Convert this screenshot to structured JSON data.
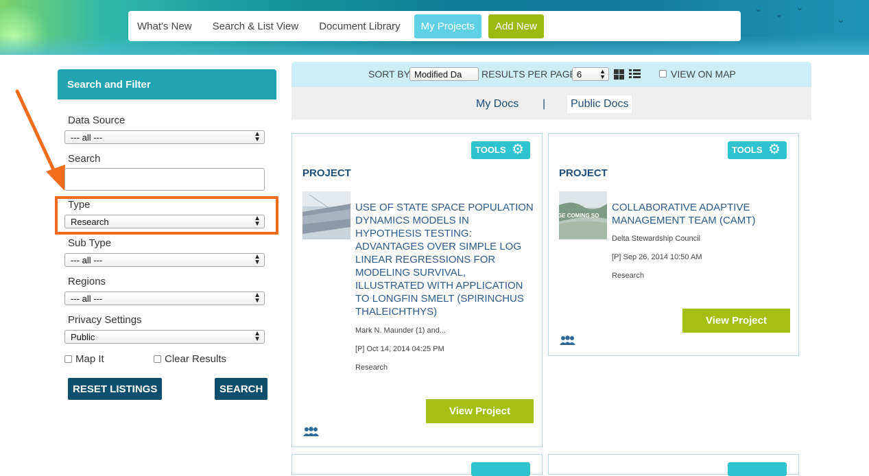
{
  "nav": {
    "items": [
      "What's New",
      "Search & List View",
      "Document Library"
    ],
    "my_projects": "My Projects",
    "add_new": "Add New"
  },
  "sidebar": {
    "header": "Search and Filter",
    "data_source": {
      "label": "Data Source",
      "value": "--- all ---"
    },
    "search": {
      "label": "Search",
      "value": ""
    },
    "type": {
      "label": "Type",
      "value": "Research"
    },
    "sub_type": {
      "label": "Sub Type",
      "value": "--- all ---"
    },
    "regions": {
      "label": "Regions",
      "value": "--- all ---"
    },
    "privacy": {
      "label": "Privacy Settings",
      "value": "Public"
    },
    "map_it": "Map It",
    "clear_results": "Clear Results",
    "reset_button": "RESET LISTINGS",
    "search_button": "SEARCH"
  },
  "toolbar": {
    "sort_by_label": "SORT BY",
    "sort_by_value": "Modified Da",
    "results_per_page_label": "RESULTS PER PAGE",
    "results_per_page_value": "6",
    "view_on_map_label": "VIEW ON MAP"
  },
  "doc_tabs": {
    "my_docs": "My Docs",
    "separator": "|",
    "public_docs": "Public Docs"
  },
  "cards": [
    {
      "tools": "TOOLS",
      "type": "PROJECT",
      "title": "Use of State Space Population Dynamics Models in Hypothesis Testing: Advantages over Simple Log Linear Regressions for Modeling Survival, Illustrated with Application to Longfin Smelt (Spirinchus thaleichthys)",
      "author": "Mark N. Maunder (1) and...",
      "date": "[P] Oct 14, 2014 04:25 PM",
      "category": "Research",
      "view_button": "View Project"
    },
    {
      "tools": "TOOLS",
      "type": "PROJECT",
      "title": "Collaborative Adaptive Management Team (CAMT)",
      "thumb_text": "GE COMING SO",
      "author": "Delta Stewardship Council",
      "date": "[P] Sep 26, 2014 10:50 AM",
      "category": "Research",
      "view_button": "View Project"
    }
  ],
  "colors": {
    "accent": "#21a3b2",
    "highlight": "#f26c1b",
    "view_button": "#a5bf12",
    "dark_button": "#0f4f6e",
    "link": "#2d5a8c"
  }
}
